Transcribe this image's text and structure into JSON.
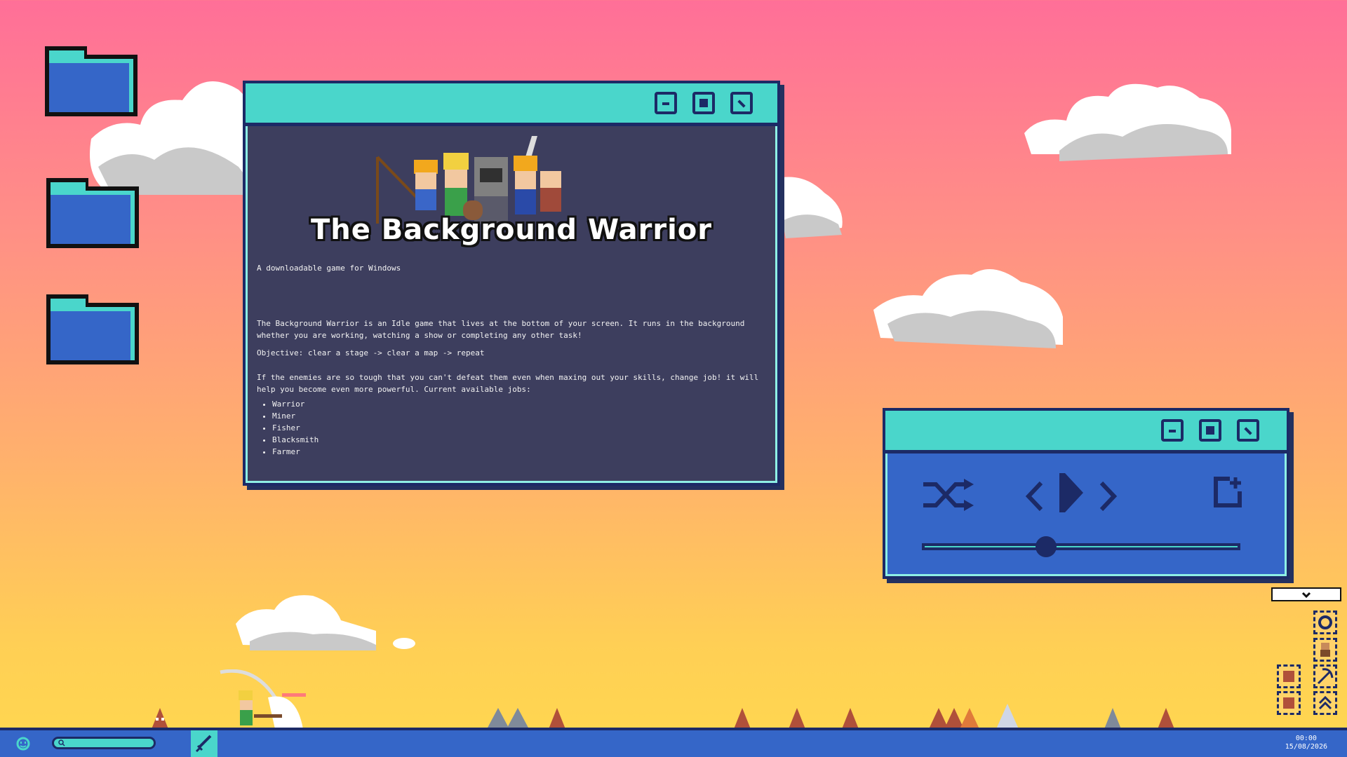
{
  "desktop": {
    "folders": [
      "folder-1",
      "folder-2",
      "folder-3"
    ]
  },
  "game_window": {
    "banner_title": "The Background Warrior",
    "subtitle": "A downloadable game for Windows",
    "description": "The Background Warrior is an Idle game that lives at the bottom of your screen. It runs in the background whether you are working, watching a show or completing any other task!",
    "objective": "Objective: clear a stage -> clear a map -> repeat",
    "jobs_intro": "If the enemies are so tough that you can't defeat them even when maxing out your skills, change job! it will help you become even more powerful. Current available jobs:",
    "jobs": [
      "Warrior",
      "Miner",
      "Fisher",
      "Blacksmith",
      "Farmer"
    ]
  },
  "music_player": {
    "volume_fraction": 0.39
  },
  "taskbar": {
    "clock_time": "00:00",
    "clock_date": "15/08/2026"
  },
  "colors": {
    "titlebar": "#4ad6cb",
    "border": "#1c2a66",
    "window_bg": "#3d3e5e",
    "player_bg": "#3566c8",
    "taskbar": "#3566c8"
  }
}
